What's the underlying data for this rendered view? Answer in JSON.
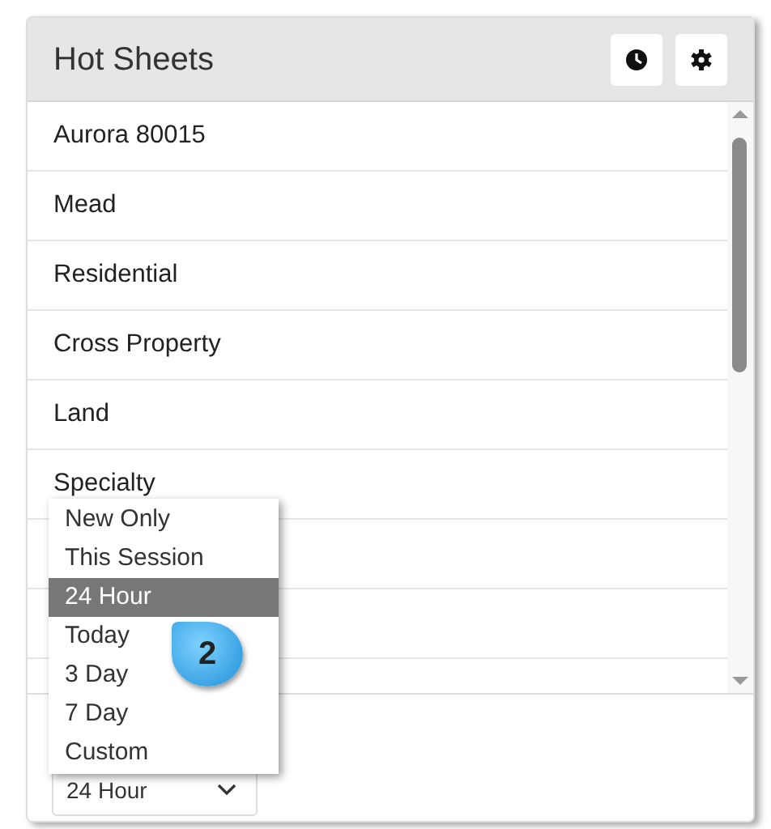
{
  "panel": {
    "title": "Hot Sheets"
  },
  "list": {
    "items": [
      {
        "label": "Aurora 80015"
      },
      {
        "label": "Mead"
      },
      {
        "label": "Residential"
      },
      {
        "label": "Cross Property"
      },
      {
        "label": "Land"
      },
      {
        "label": "Specialty"
      }
    ]
  },
  "time_filter": {
    "value": "24 Hour",
    "options": [
      {
        "label": "New Only",
        "selected": false
      },
      {
        "label": "This Session",
        "selected": false
      },
      {
        "label": "24 Hour",
        "selected": true
      },
      {
        "label": "Today",
        "selected": false
      },
      {
        "label": "3 Day",
        "selected": false
      },
      {
        "label": "7 Day",
        "selected": false
      },
      {
        "label": "Custom",
        "selected": false
      }
    ]
  },
  "callout": {
    "label": "2"
  }
}
